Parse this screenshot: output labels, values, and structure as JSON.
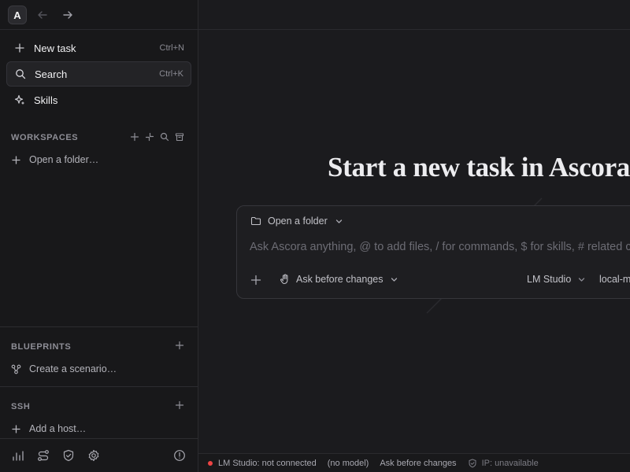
{
  "app": {
    "logo_letter": "A"
  },
  "sidebar": {
    "menu": [
      {
        "label": "New task",
        "shortcut": "Ctrl+N",
        "icon": "plus-icon"
      },
      {
        "label": "Search",
        "shortcut": "Ctrl+K",
        "icon": "search-icon"
      },
      {
        "label": "Skills",
        "shortcut": "",
        "icon": "sparkle-icon"
      }
    ],
    "workspaces": {
      "title": "WORKSPACES",
      "open_folder": "Open a folder…"
    },
    "blueprints": {
      "title": "BLUEPRINTS",
      "create": "Create a scenario…"
    },
    "ssh": {
      "title": "SSH",
      "add_host": "Add a host…"
    }
  },
  "main": {
    "heading": "Start a new task in Ascora",
    "composer": {
      "folder_label": "Open a folder",
      "placeholder": "Ask Ascora anything, @ to add files, / for commands, $ for skills, # related conversations",
      "mode_label": "Ask before changes",
      "provider_label": "LM Studio",
      "model_label": "local-model"
    }
  },
  "status": {
    "connection": "LM Studio: not connected",
    "model": "(no model)",
    "mode": "Ask before changes",
    "ip": "IP: unavailable",
    "dot_color": "#ef4444"
  }
}
